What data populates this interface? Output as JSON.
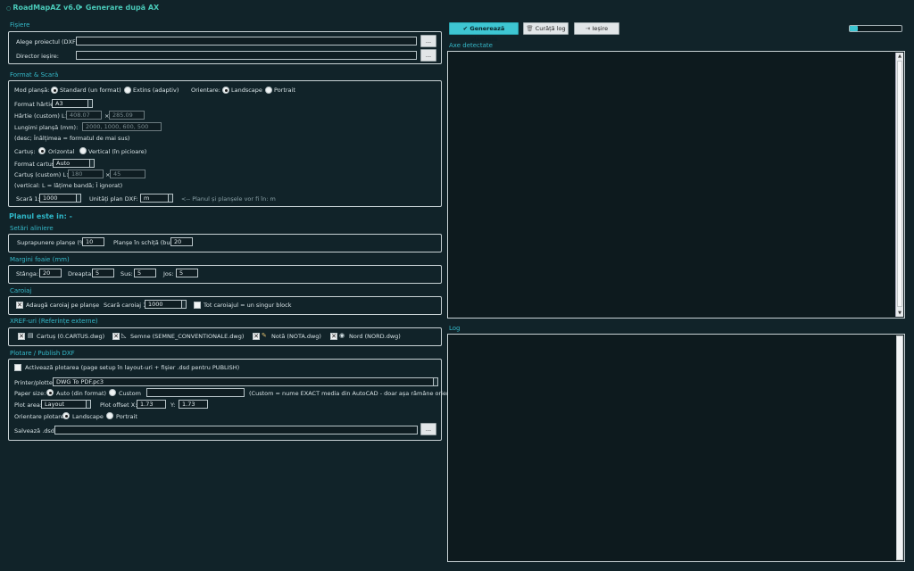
{
  "header": {
    "app_title": "RoadMapAZ v6.0",
    "mode_title": "Generare după AX"
  },
  "toolbar": {
    "generate": "✔ Generează planșele",
    "clear_log": "Curăță log",
    "exit": "Ieșire",
    "progress": 0.15
  },
  "fisiere": {
    "title": "Fișiere",
    "dxf_label": "Alege proiectul (DXF):",
    "dxf_value": "",
    "out_label": "Director ieșire:",
    "out_value": "",
    "browse": "..."
  },
  "format": {
    "title": "Format & Scară",
    "mode_label": "Mod planșă:",
    "mode_standard": "Standard (un format)",
    "mode_extins": "Extins (adaptiv)",
    "orient_label": "Orientare:",
    "orient_landscape": "Landscape",
    "orient_portrait": "Portrait",
    "paper_format_label": "Format hârtie:",
    "paper_format": "A3",
    "paper_custom_label": "Hârtie (custom) L×Î:",
    "paper_w": "408.07",
    "paper_h": "285.09",
    "times": "×",
    "lengths_label": "Lungimi planșă (mm):",
    "lengths_value": "2000, 1000, 600, 500",
    "lengths_hint": "(desc; Înălțimea = formatul de mai sus)",
    "cartus_label": "Cartuș:",
    "cartus_oriz": "Orizontal",
    "cartus_vert": "Vertical (în picioare)",
    "cartus_format_label": "Format cartuș:",
    "cartus_format": "Auto",
    "cartus_custom_label": "Cartuș (custom) L×Î:",
    "cartus_w": "180",
    "cartus_h": "45",
    "cartus_hint": "(vertical: L = lățime bandă; Î ignorat)",
    "scale_label": "Scară 1:",
    "scale": "1000",
    "units_label": "Unități plan DXF:",
    "units": "m",
    "units_hint": "<-- Planul și planșele vor fi în: m"
  },
  "plan_status": "Planul este in: -",
  "aliniere": {
    "title": "Setări aliniere",
    "overlap_label": "Suprapunere planșe (%):",
    "overlap": "10",
    "per_sheet_label": "Planșe în schiță (buc):",
    "per_sheet": "20"
  },
  "margini": {
    "title": "Margini foaie (mm)",
    "left_label": "Stânga:",
    "left": "20",
    "right_label": "Dreapta:",
    "right": "5",
    "top_label": "Sus:",
    "top": "5",
    "bottom_label": "Jos:",
    "bottom": "5"
  },
  "caroiaj": {
    "title": "Caroiaj",
    "add_label": "Adaugă caroiaj pe planșe",
    "scale_label": "Scară caroiaj 1:",
    "scale": "1000",
    "single_label": "Tot caroiajul = un singur block"
  },
  "xref": {
    "title": "XREF-uri (Referințe externe)",
    "items": [
      "Cartuș (0.CARTUS.dwg)",
      "Semne (SEMNE_CONVENTIONALE.dwg)",
      "Notă (NOTA.dwg)",
      "Nord (NORD.dwg)"
    ]
  },
  "plot": {
    "title": "Plotare / Publish DXF",
    "activate_label": "Activează plotarea (page setup în layout-uri + fișier .dsd pentru PUBLISH)",
    "printer_label": "Printer/plotter:",
    "printer": "DWG To PDF.pc3",
    "paper_label": "Paper size:",
    "paper_auto": "Auto (din format)",
    "paper_custom": "Custom",
    "paper_custom_value": "",
    "paper_hint": "(Custom = nume EXACT media din AutoCAD - doar așa rămâne orientarea)",
    "area_label": "Plot area:",
    "area": "Layout",
    "offset_label": "Plot offset  X:",
    "offset_x": "1.73",
    "offset_y_label": "Y:",
    "offset_y": "1.73",
    "orient_label": "Orientare plotare:",
    "orient_landscape": "Landscape",
    "orient_portrait": "Portrait",
    "dsd_label": "Salvează .dsd:",
    "dsd_value": "",
    "browse": "..."
  },
  "axes": {
    "title": "Axe detectate"
  },
  "log": {
    "title": "Log"
  }
}
